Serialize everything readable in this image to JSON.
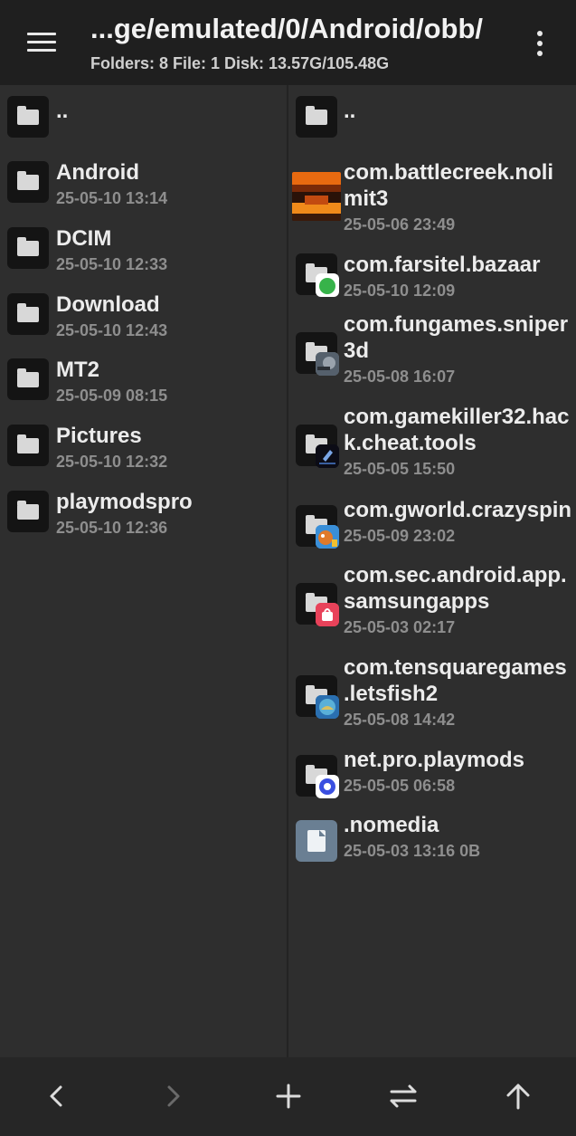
{
  "header": {
    "path_title": "...ge/emulated/0/Android/obb/",
    "info": "Folders: 8  File: 1  Disk: 13.57G/105.48G",
    "menu_icon": "hamburger-menu-icon",
    "more_icon": "more-vert-icon"
  },
  "left_pane": {
    "parent_label": "..",
    "items": [
      {
        "name": "Android",
        "date": "25-05-10 13:14"
      },
      {
        "name": "DCIM",
        "date": "25-05-10 12:33"
      },
      {
        "name": "Download",
        "date": "25-05-10 12:43"
      },
      {
        "name": "MT2",
        "date": "25-05-09 08:15"
      },
      {
        "name": "Pictures",
        "date": "25-05-10 12:32"
      },
      {
        "name": "playmodspro",
        "date": "25-05-10 12:36"
      }
    ]
  },
  "right_pane": {
    "parent_label": "..",
    "items": [
      {
        "name_l1": "com.battlecreek.noli",
        "name_l2": "mit3",
        "date": "25-05-06 23:49",
        "icon": "game-thumbnail-icon"
      },
      {
        "name_l1": "com.farsitel.bazaar",
        "date": "25-05-10 12:09",
        "icon": "bazaar-app-icon"
      },
      {
        "name_l1": "com.fungames.sniper",
        "name_l2": "3d",
        "date": "25-05-08 16:07",
        "icon": "sniper-app-icon"
      },
      {
        "name_l1": "com.gamekiller32.hac",
        "name_l2": "k.cheat.tools",
        "date": "25-05-05 15:50",
        "icon": "gamekiller-app-icon"
      },
      {
        "name_l1": "com.gworld.crazyspin",
        "date": "25-05-09 23:02",
        "icon": "crazyspin-app-icon"
      },
      {
        "name_l1": "com.sec.android.app.",
        "name_l2": "samsungapps",
        "date": "25-05-03 02:17",
        "icon": "galaxy-store-icon"
      },
      {
        "name_l1": "com.tensquaregames",
        "name_l2": ".letsfish2",
        "date": "25-05-08 14:42",
        "icon": "letsfish-app-icon"
      },
      {
        "name_l1": "net.pro.playmods",
        "date": "25-05-05 06:58",
        "icon": "playmods-app-icon"
      },
      {
        "name_l1": ".nomedia",
        "date": "25-05-03 13:16  0B",
        "icon": "file-icon"
      }
    ]
  },
  "bottom_bar": {
    "buttons": [
      "back-arrow-icon",
      "forward-arrow-icon",
      "plus-icon",
      "swap-icon",
      "up-arrow-icon"
    ]
  },
  "colors": {
    "topbar": "#1f1f1f",
    "pane": "#2e2e2e",
    "bottombar": "#262626",
    "text": "#ececec",
    "subtext": "#8e8e8e"
  }
}
